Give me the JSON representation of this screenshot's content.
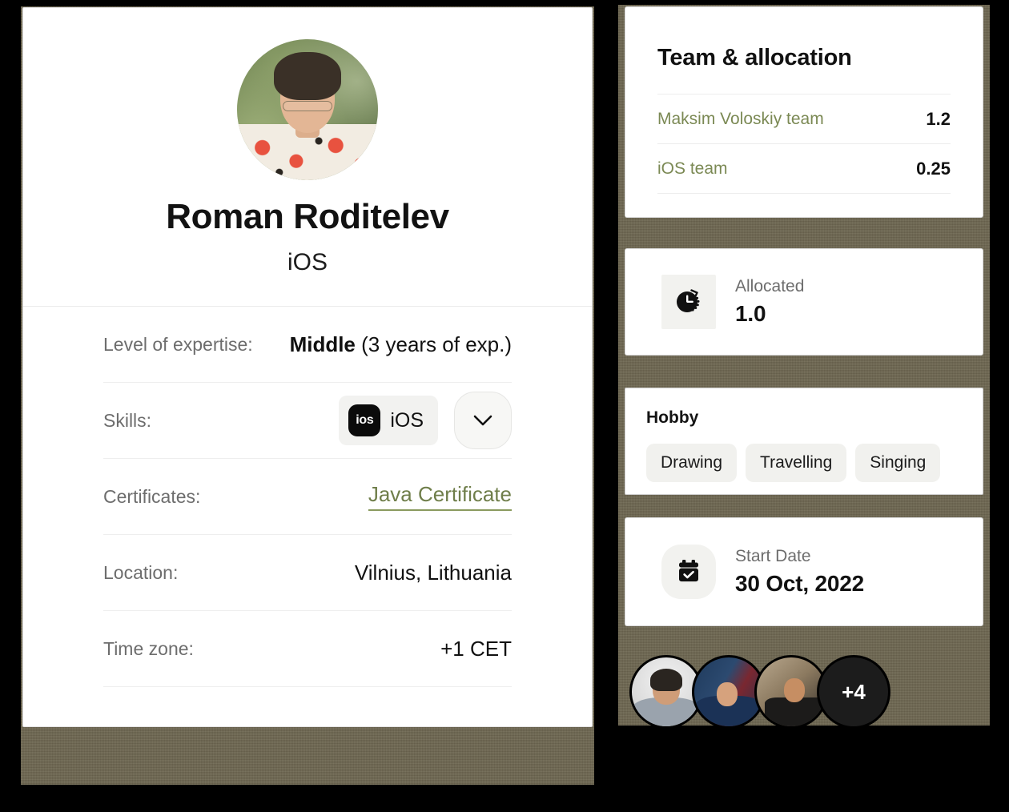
{
  "profile": {
    "name": "Roman Roditelev",
    "role": "iOS",
    "avatar_icon": "user-photo",
    "info_rows": [
      {
        "label": "Level of expertise:",
        "value_strong": "Middle",
        "value_rest": "(3 years of exp.)"
      },
      {
        "label": "Skills:",
        "skill_logo_text": "ios",
        "skill_name": "iOS",
        "expand_icon": "chevron-down-icon"
      },
      {
        "label": "Certificates:",
        "link_text": "Java Certificate"
      },
      {
        "label": "Location:",
        "value": "Vilnius, Lithuania"
      },
      {
        "label": "Time zone:",
        "value": "+1 CET"
      }
    ]
  },
  "team_panel": {
    "title": "Team & allocation",
    "rows": [
      {
        "name": "Maksim Voloskiy team",
        "value": "1.2"
      },
      {
        "name": "iOS team",
        "value": "0.25"
      }
    ]
  },
  "allocated": {
    "icon": "clock-progress-icon",
    "label": "Allocated",
    "value": "1.0"
  },
  "hobby": {
    "title": "Hobby",
    "chips": [
      "Drawing",
      "Travelling",
      "Singing"
    ]
  },
  "start_date": {
    "icon": "calendar-check-icon",
    "label": "Start Date",
    "value": "30 Oct, 2022"
  },
  "avatar_stack": {
    "overflow_label": "+4",
    "avatars": [
      "team-member-1",
      "team-member-2",
      "team-member-3"
    ]
  },
  "colors": {
    "accent_olive": "#7b8954",
    "link_olive": "#6f7e4a",
    "backdrop": "#6e6751",
    "page_bg": "#000000"
  }
}
